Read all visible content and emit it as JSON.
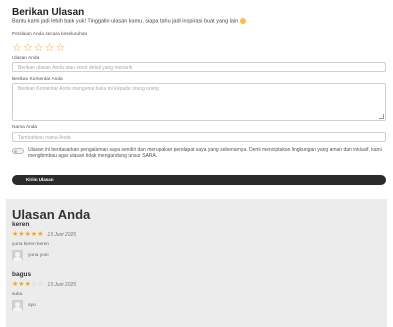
{
  "form": {
    "title": "Berikan Ulasan",
    "subtitle": "Bantu kami jadi lebih baik yuk! Tinggalin ulasan kamu, siapa tahu jadi inspirasi buat yang lain",
    "rating_label": "Penilaian Anda secara keseluruhan",
    "rating_value": 0,
    "rating_max": 5,
    "review_label": "Ulasan Anda",
    "review_placeholder": "Berikan ulasan Anda atau sorot detail yang menarik",
    "comment_label": "Berikan Komentar Anda",
    "comment_placeholder": "Berikan Komentar Anda mengenai buku ini kepada orang orang",
    "name_label": "Nama Anda",
    "name_placeholder": "Tambahkan nama Anda",
    "consent_text": "Ulasan ini berdasarkan pengalaman saya sendiri dan merupakan pendapat saya yang sebenarnya. Demi menciptakan lingkungan yang aman dan inklusif, kami menghimbau agar ulasan tidak mengandung unsur SARA.",
    "submit_label": "Kirim Ulasan",
    "star_color": "#f0a91e",
    "button_color": "#2b2b2b"
  },
  "reviews": {
    "title": "Ulasan Anda",
    "background": "#ececec",
    "items": [
      {
        "title": "keren",
        "rating": 5,
        "date": "13 Juni 2025",
        "body": "yuna keren keren",
        "author": "yuna yuni",
        "avatar_icon": "user-avatar-icon"
      },
      {
        "title": "bagus",
        "rating": 3,
        "date": "13 Juni 2025",
        "body": "suka",
        "author": "ayu",
        "avatar_icon": "user-avatar-icon"
      }
    ]
  }
}
